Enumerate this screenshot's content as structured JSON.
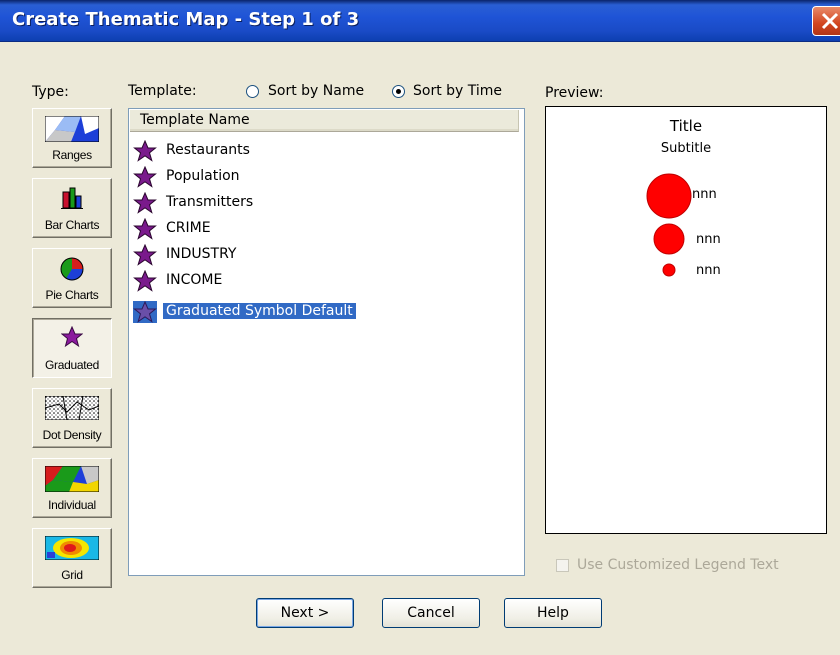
{
  "window": {
    "title": "Create Thematic Map - Step 1 of 3",
    "close_label": "close"
  },
  "type_panel": {
    "label": "Type:",
    "buttons": [
      {
        "label": "Ranges",
        "icon": "ranges-icon"
      },
      {
        "label": "Bar Charts",
        "icon": "bar-chart-icon"
      },
      {
        "label": "Pie Charts",
        "icon": "pie-chart-icon"
      },
      {
        "label": "Graduated",
        "icon": "graduated-star-icon",
        "selected": true
      },
      {
        "label": "Dot Density",
        "icon": "dot-density-icon"
      },
      {
        "label": "Individual",
        "icon": "individual-icon"
      },
      {
        "label": "Grid",
        "icon": "grid-icon"
      }
    ]
  },
  "template": {
    "label": "Template:",
    "sort_by_name": "Sort by Name",
    "sort_by_time": "Sort by Time",
    "sort_selected": "time",
    "column_header": "Template Name",
    "items": [
      {
        "name": "Restaurants"
      },
      {
        "name": "Population"
      },
      {
        "name": "Transmitters"
      },
      {
        "name": "CRIME"
      },
      {
        "name": "INDUSTRY"
      },
      {
        "name": "INCOME"
      },
      {
        "name": "Graduated Symbol Default",
        "selected": true
      }
    ]
  },
  "preview": {
    "label": "Preview:",
    "title": "Title",
    "subtitle": "Subtitle",
    "legend": [
      "nnn",
      "nnn",
      "nnn"
    ],
    "symbol_color": "#ff0000"
  },
  "customize_legend": {
    "label": "Use Customized Legend Text",
    "checked": false,
    "enabled": false
  },
  "buttons": {
    "next": "Next >",
    "cancel": "Cancel",
    "help": "Help"
  },
  "colors": {
    "star": "#7a1a8c",
    "selection": "#316ac5"
  }
}
